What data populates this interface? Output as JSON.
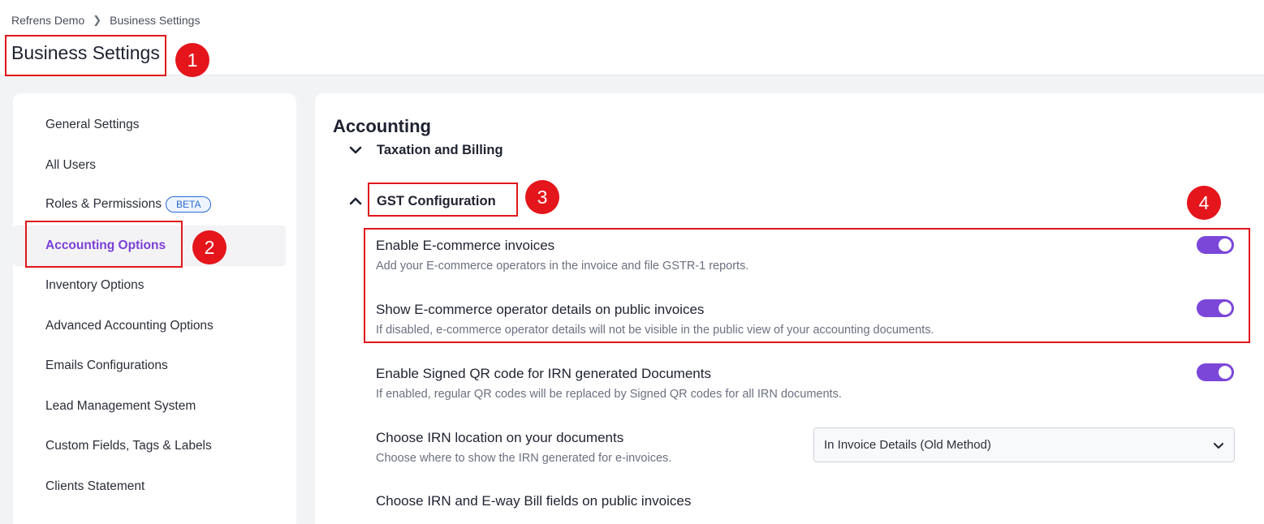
{
  "breadcrumb": {
    "root": "Refrens Demo",
    "current": "Business Settings"
  },
  "page_title": "Business Settings",
  "sidebar": {
    "items": [
      {
        "label": "General Settings"
      },
      {
        "label": "All Users"
      },
      {
        "label": "Roles & Permissions",
        "badge": "BETA"
      },
      {
        "label": "Accounting Options",
        "active": true
      },
      {
        "label": "Inventory Options"
      },
      {
        "label": "Advanced Accounting Options"
      },
      {
        "label": "Emails Configurations"
      },
      {
        "label": "Lead Management System"
      },
      {
        "label": "Custom Fields, Tags & Labels"
      },
      {
        "label": "Clients Statement"
      }
    ]
  },
  "main": {
    "title": "Accounting",
    "sections": [
      {
        "label": "Taxation and Billing",
        "expanded": false
      },
      {
        "label": "GST Configuration",
        "expanded": true
      }
    ],
    "settings": [
      {
        "label": "Enable E-commerce invoices",
        "desc": "Add your E-commerce operators in the invoice and file GSTR-1 reports.",
        "enabled": true
      },
      {
        "label": "Show E-commerce operator details on public invoices",
        "desc": "If disabled, e-commerce operator details will not be visible in the public view of your accounting documents.",
        "enabled": true
      },
      {
        "label": "Enable Signed QR code for IRN generated Documents",
        "desc": "If enabled, regular QR codes will be replaced by Signed QR codes for all IRN documents.",
        "enabled": true
      },
      {
        "label": "Choose IRN location on your documents",
        "desc": "Choose where to show the IRN generated for e-invoices."
      },
      {
        "label": "Choose IRN and E-way Bill fields on public invoices"
      }
    ],
    "irn_location_select": {
      "value": "In Invoice Details (Old Method)"
    }
  },
  "annotations": {
    "n1": "1",
    "n2": "2",
    "n3": "3",
    "n4": "4"
  },
  "colors": {
    "accent": "#7b47d9",
    "callout": "#e4151b"
  }
}
